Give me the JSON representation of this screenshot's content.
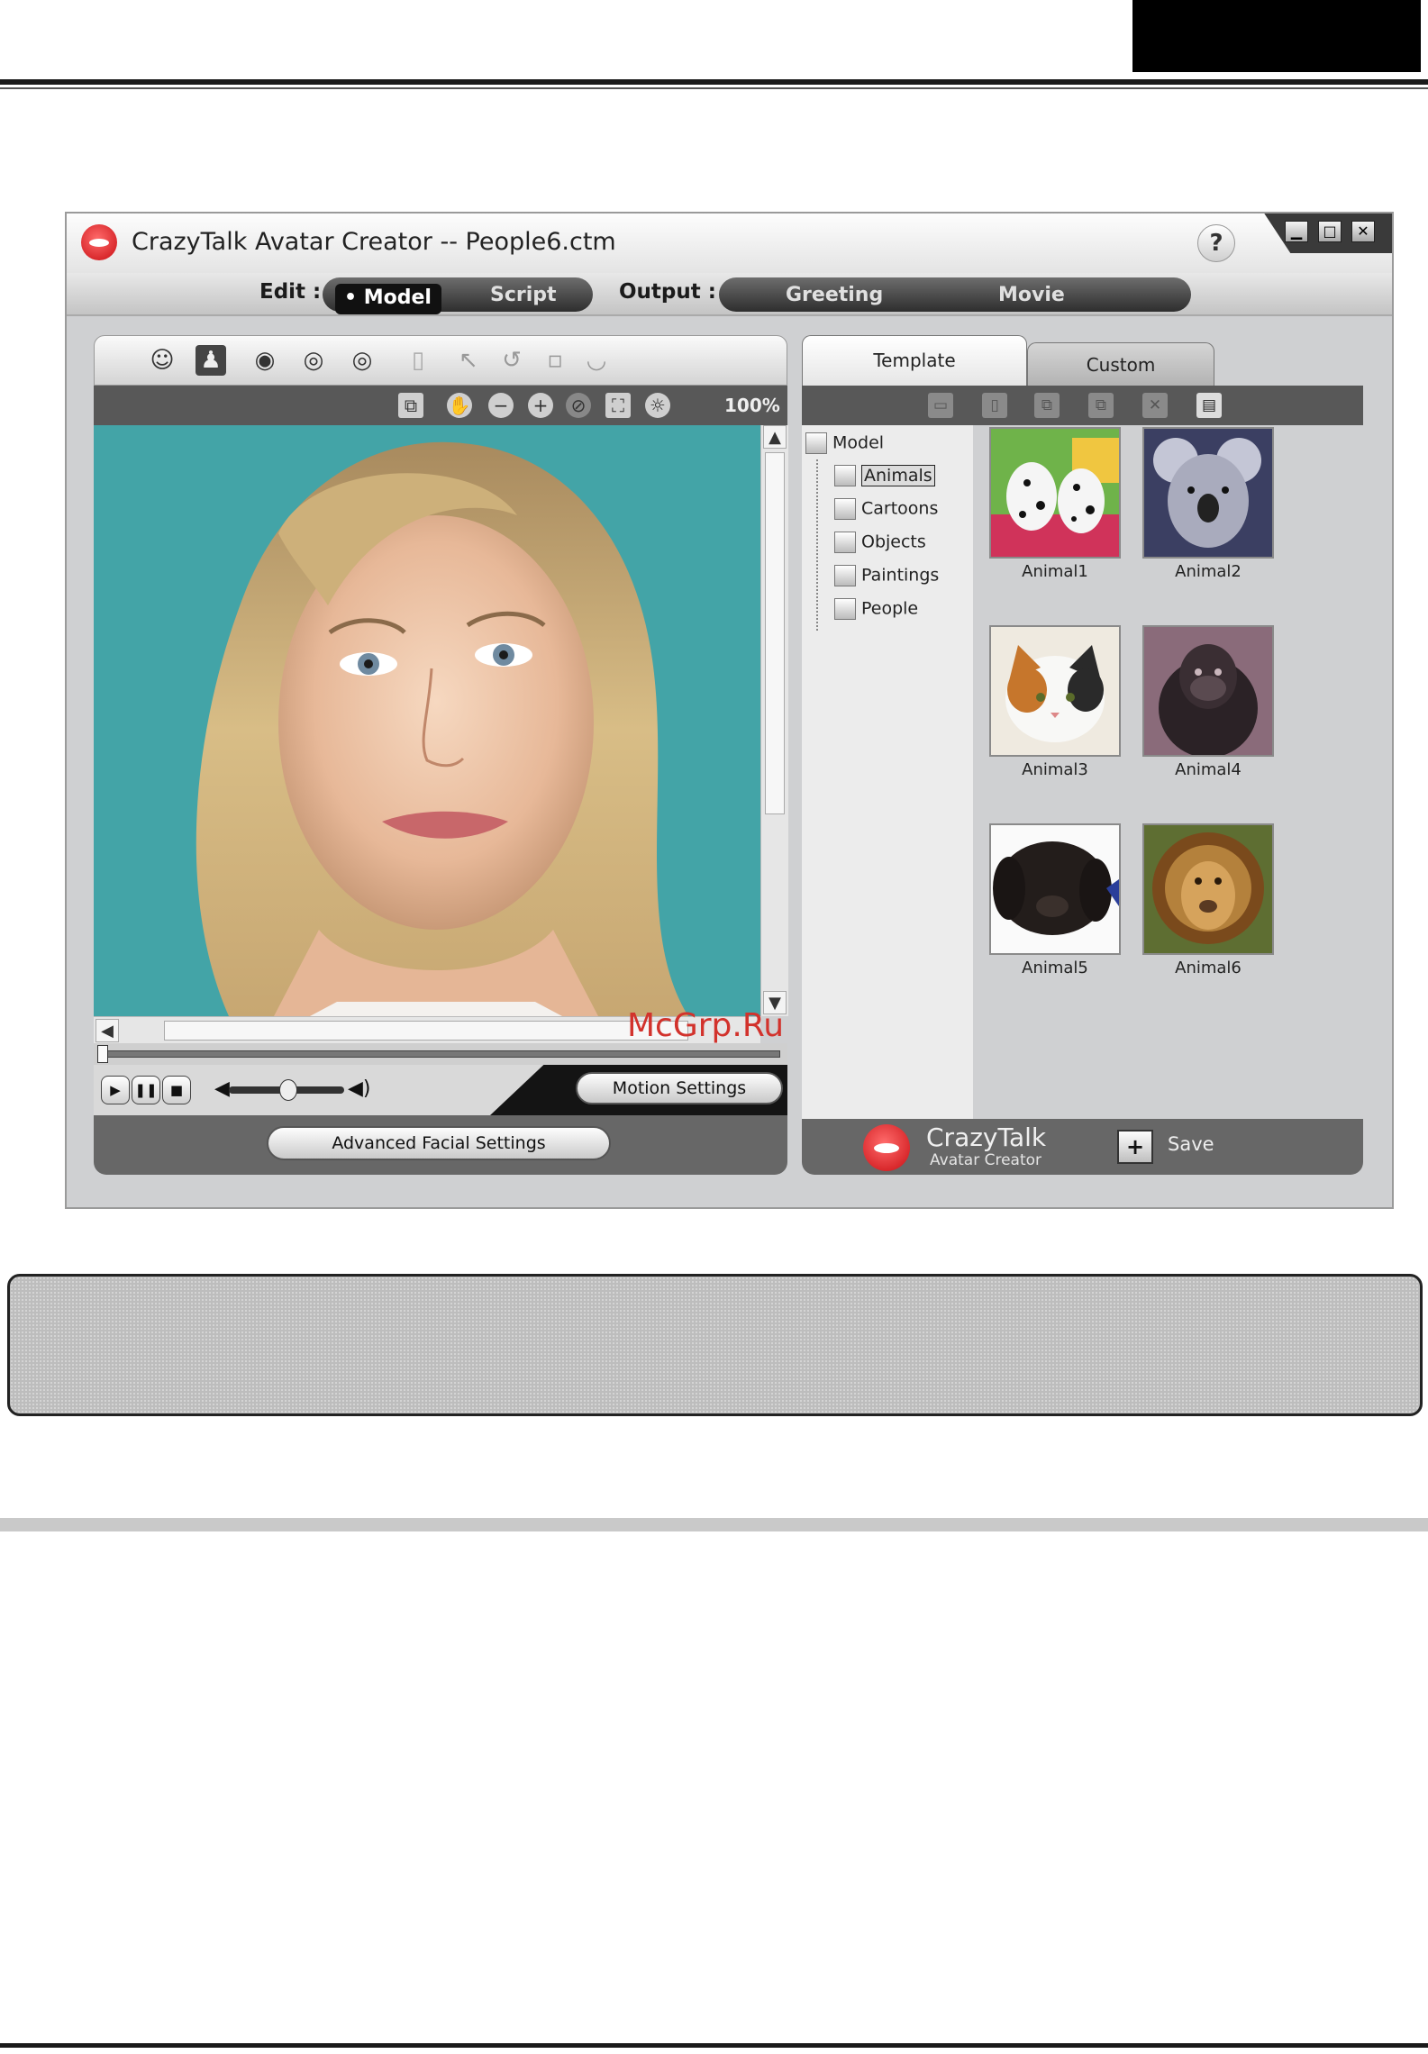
{
  "window": {
    "title": "CrazyTalk Avatar Creator -- People6.ctm",
    "help_label": "?",
    "controls": {
      "minimize": "▁",
      "maximize": "□",
      "close": "✕"
    }
  },
  "menu": {
    "edit_label": "Edit :",
    "model_label": "• Model",
    "script_label": "Script",
    "output_label": "Output :",
    "greeting_label": "Greeting",
    "movie_label": "Movie"
  },
  "left_panel": {
    "zoom_level": "100%",
    "motion_settings_label": "Motion Settings",
    "advanced_facial_settings_label": "Advanced Facial Settings"
  },
  "right_panel": {
    "tabs": {
      "template": "Template",
      "custom": "Custom"
    },
    "tree": {
      "root": "Model",
      "items": [
        "Animals",
        "Cartoons",
        "Objects",
        "Paintings",
        "People"
      ],
      "selected": "Animals"
    },
    "thumbnails": [
      "Animal1",
      "Animal2",
      "Animal3",
      "Animal4",
      "Animal5",
      "Animal6"
    ],
    "brand": {
      "name": "CrazyTalk",
      "sub": "Avatar Creator"
    },
    "save_label": "Save"
  },
  "watermark": "McGrp.Ru",
  "colors": {
    "accent_red": "#c90d12",
    "photo_bg": "#43a4a7",
    "panel_dark": "#585858"
  }
}
